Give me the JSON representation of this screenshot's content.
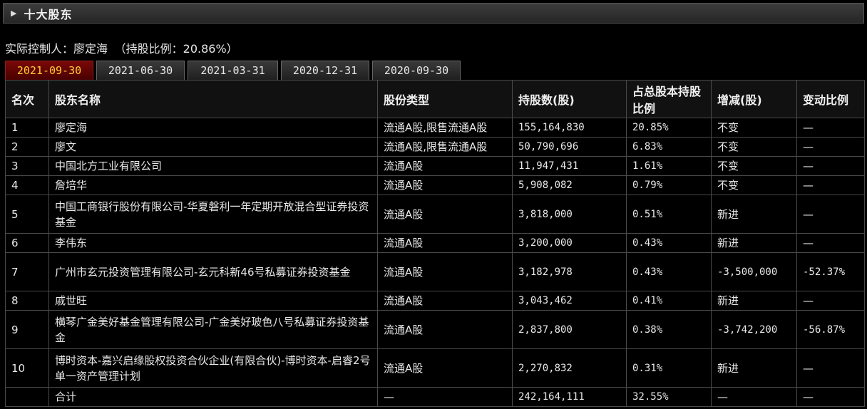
{
  "section": {
    "title": "十大股东",
    "toggle_icon": "triangle-right-icon"
  },
  "controller": {
    "label": "实际控制人：",
    "name": "廖定海",
    "ratio_text": "（持股比例：20.86%）"
  },
  "tabs": [
    "2021-09-30",
    "2021-06-30",
    "2021-03-31",
    "2020-12-31",
    "2020-09-30"
  ],
  "active_tab": 0,
  "colors": {
    "active_tab_bg": "#6a0000",
    "active_tab_text": "#ffcc33"
  },
  "table": {
    "headers": [
      "名次",
      "股东名称",
      "股份类型",
      "持股数(股)",
      "占总股本持股比例",
      "增减(股)",
      "变动比例"
    ],
    "rows": [
      [
        "1",
        "廖定海",
        "流通A股,限售流通A股",
        "155,164,830",
        "20.85%",
        "不变",
        "—"
      ],
      [
        "2",
        "廖文",
        "流通A股,限售流通A股",
        "50,790,696",
        "6.83%",
        "不变",
        "—"
      ],
      [
        "3",
        "中国北方工业有限公司",
        "流通A股",
        "11,947,431",
        "1.61%",
        "不变",
        "—"
      ],
      [
        "4",
        "詹培华",
        "流通A股",
        "5,908,082",
        "0.79%",
        "不变",
        "—"
      ],
      [
        "5",
        "中国工商银行股份有限公司-华夏磐利一年定期开放混合型证券投资基金",
        "流通A股",
        "3,818,000",
        "0.51%",
        "新进",
        "—"
      ],
      [
        "6",
        "李伟东",
        "流通A股",
        "3,200,000",
        "0.43%",
        "新进",
        "—"
      ],
      [
        "7",
        "广州市玄元投资管理有限公司-玄元科新46号私募证券投资基金",
        "流通A股",
        "3,182,978",
        "0.43%",
        "-3,500,000",
        "-52.37%"
      ],
      [
        "8",
        "戚世旺",
        "流通A股",
        "3,043,462",
        "0.41%",
        "新进",
        "—"
      ],
      [
        "9",
        "横琴广金美好基金管理有限公司-广金美好玻色八号私募证券投资基金",
        "流通A股",
        "2,837,800",
        "0.38%",
        "-3,742,200",
        "-56.87%"
      ],
      [
        "10",
        "博时资本-嘉兴启缘股权投资合伙企业(有限合伙)-博时资本-启睿2号单一资产管理计划",
        "流通A股",
        "2,270,832",
        "0.31%",
        "新进",
        "—"
      ]
    ],
    "total": [
      "",
      "合计",
      "—",
      "242,164,111",
      "32.55%",
      "—",
      "—"
    ]
  }
}
